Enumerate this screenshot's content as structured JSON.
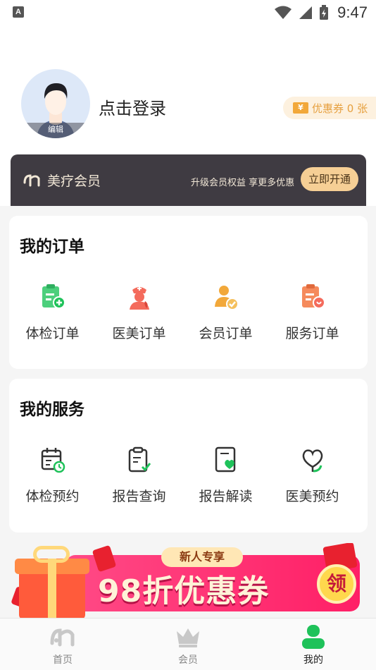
{
  "status_bar": {
    "time": "9:47",
    "left_icon": "A",
    "icons": [
      "wifi-icon",
      "signal-icon",
      "battery-icon"
    ]
  },
  "profile": {
    "avatar_edit_label": "编辑",
    "login_prompt": "点击登录",
    "coupon": {
      "icon": "¥",
      "label": "优惠券 0 张"
    }
  },
  "vip": {
    "title": "美疗会员",
    "description": "升级会员权益 享更多优惠",
    "button": "立即开通"
  },
  "orders": {
    "title": "我的订单",
    "items": [
      {
        "label": "体检订单",
        "icon": "clipboard-plus-icon"
      },
      {
        "label": "医美订单",
        "icon": "nurse-icon"
      },
      {
        "label": "会员订单",
        "icon": "member-check-icon"
      },
      {
        "label": "服务订单",
        "icon": "service-clipboard-icon"
      }
    ]
  },
  "services": {
    "title": "我的服务",
    "items": [
      {
        "label": "体检预约",
        "icon": "calendar-clock-icon"
      },
      {
        "label": "报告查询",
        "icon": "clipboard-check-icon"
      },
      {
        "label": "报告解读",
        "icon": "document-heart-icon"
      },
      {
        "label": "医美预约",
        "icon": "heart-leaf-icon"
      }
    ]
  },
  "banner": {
    "tag": "新人专享",
    "headline": "98折优惠券",
    "button": "领"
  },
  "tabbar": {
    "items": [
      {
        "label": "首页",
        "icon": "home-logo-icon",
        "active": false
      },
      {
        "label": "会员",
        "icon": "crown-icon",
        "active": false
      },
      {
        "label": "我的",
        "icon": "user-icon",
        "active": true
      }
    ]
  },
  "colors": {
    "accent_green": "#1fc25a",
    "coupon_orange": "#e6a03f",
    "vip_dark": "#3f3b42",
    "vip_gold": "#f6cf95",
    "order_icon_green": "#4ccf7c",
    "order_icon_red": "#f46b5c",
    "order_icon_orange": "#f2a83a",
    "banner_pink": "#ff2f73"
  }
}
